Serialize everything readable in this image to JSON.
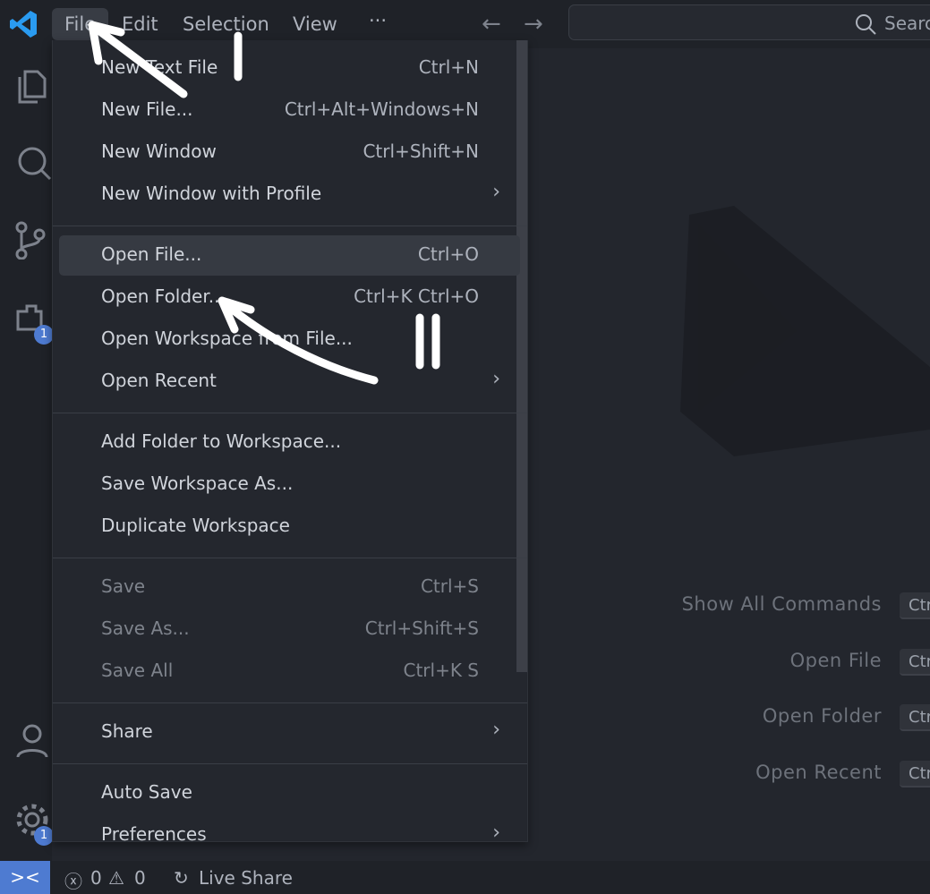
{
  "menubar": {
    "items": [
      "File",
      "Edit",
      "Selection",
      "View",
      "···"
    ],
    "search_label": "Search"
  },
  "activity": {
    "extensions_badge": "1",
    "settings_badge": "1"
  },
  "file_menu": {
    "groups": [
      [
        {
          "label": "New Text File",
          "key": "Ctrl+N"
        },
        {
          "label": "New File...",
          "key": "Ctrl+Alt+Windows+N"
        },
        {
          "label": "New Window",
          "key": "Ctrl+Shift+N"
        },
        {
          "label": "New Window with Profile",
          "submenu": true
        }
      ],
      [
        {
          "label": "Open File...",
          "key": "Ctrl+O",
          "highlighted": true
        },
        {
          "label": "Open Folder...",
          "key": "Ctrl+K Ctrl+O"
        },
        {
          "label": "Open Workspace from File...",
          "key": ""
        },
        {
          "label": "Open Recent",
          "submenu": true
        }
      ],
      [
        {
          "label": "Add Folder to Workspace..."
        },
        {
          "label": "Save Workspace As..."
        },
        {
          "label": "Duplicate Workspace"
        }
      ],
      [
        {
          "label": "Save",
          "key": "Ctrl+S",
          "disabled": true
        },
        {
          "label": "Save As...",
          "key": "Ctrl+Shift+S",
          "disabled": true
        },
        {
          "label": "Save All",
          "key": "Ctrl+K S",
          "disabled": true
        }
      ],
      [
        {
          "label": "Share",
          "submenu": true
        }
      ],
      [
        {
          "label": "Auto Save"
        },
        {
          "label": "Preferences",
          "submenu": true
        }
      ]
    ]
  },
  "welcome": {
    "shortcuts": [
      {
        "label": "Show All Commands",
        "key": "Ctrl"
      },
      {
        "label": "Open File",
        "key": "Ctrl"
      },
      {
        "label": "Open Folder",
        "key": "Ctrl"
      },
      {
        "label": "Open Recent",
        "key": "Ctrl"
      }
    ]
  },
  "status": {
    "errors": "0",
    "warnings": "0",
    "live_share": "Live Share"
  },
  "colors": {
    "accent": "#4e7bd1",
    "logo": "#2a9bf0"
  }
}
